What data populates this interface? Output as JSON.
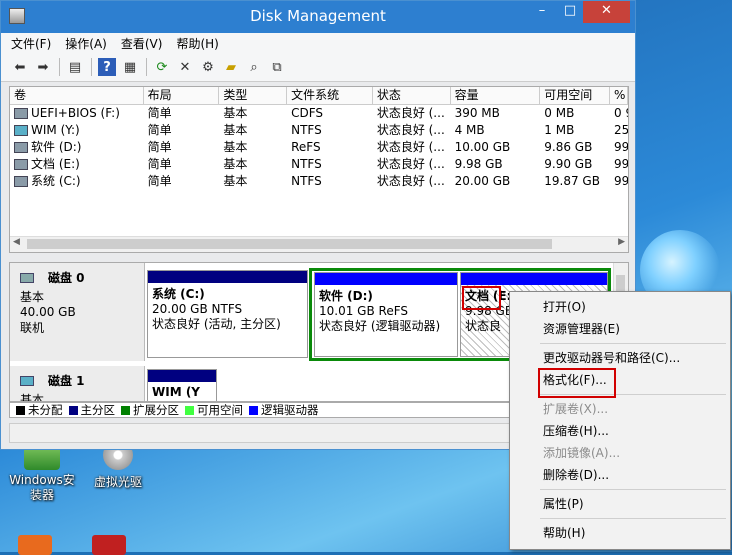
{
  "window": {
    "title": "Disk Management",
    "buttons": {
      "min": "–",
      "max": "□",
      "close": "✕"
    }
  },
  "menubar": [
    "文件(F)",
    "操作(A)",
    "查看(V)",
    "帮助(H)"
  ],
  "toolbar_icons": [
    "back-icon",
    "forward-icon",
    "console-icon",
    "help-icon",
    "properties-icon",
    "refresh-icon",
    "delete-icon",
    "settings-icon",
    "open-folder-icon",
    "search-icon",
    "export-icon"
  ],
  "volumes": {
    "headers": [
      "卷",
      "布局",
      "类型",
      "文件系统",
      "状态",
      "容量",
      "可用空间",
      "%"
    ],
    "rows": [
      [
        "UEFI+BIOS (F:)",
        "简单",
        "基本",
        "CDFS",
        "状态良好 (...",
        "390 MB",
        "0 MB",
        "0 9"
      ],
      [
        "WIM (Y:)",
        "简单",
        "基本",
        "NTFS",
        "状态良好 (...",
        "4 MB",
        "1 MB",
        "25"
      ],
      [
        "软件 (D:)",
        "简单",
        "基本",
        "ReFS",
        "状态良好 (...",
        "10.00 GB",
        "9.86 GB",
        "99"
      ],
      [
        "文档 (E:)",
        "简单",
        "基本",
        "NTFS",
        "状态良好 (...",
        "9.98 GB",
        "9.90 GB",
        "99"
      ],
      [
        "系统 (C:)",
        "简单",
        "基本",
        "NTFS",
        "状态良好 (...",
        "20.00 GB",
        "19.87 GB",
        "99"
      ]
    ]
  },
  "disks": {
    "disk0": {
      "name": "磁盘 0",
      "type": "基本",
      "size": "40.00 GB",
      "state": "联机",
      "parts": {
        "c": {
          "name": "系统  (C:)",
          "size": "20.00 GB NTFS",
          "status": "状态良好 (活动, 主分区)"
        },
        "d": {
          "name": "软件  (D:)",
          "size": "10.01 GB ReFS",
          "status": "状态良好 (逻辑驱动器)"
        },
        "e": {
          "name": "文档",
          "name_rest": "(E:",
          "size": "9.98 GB",
          "status": "状态良"
        }
      }
    },
    "disk1": {
      "name": "磁盘 1",
      "type": "基本",
      "part_name": "WIM  (Y"
    }
  },
  "legend": [
    {
      "label": "未分配",
      "color": "#000000"
    },
    {
      "label": "主分区",
      "color": "#000080"
    },
    {
      "label": "扩展分区",
      "color": "#008000"
    },
    {
      "label": "可用空间",
      "color": "#40ff40"
    },
    {
      "label": "逻辑驱动器",
      "color": "#0000ff"
    }
  ],
  "context_menu": {
    "open": "打开(O)",
    "explorer": "资源管理器(E)",
    "change_letter": "更改驱动器号和路径(C)...",
    "format": "格式化(F)...",
    "extend": "扩展卷(X)...",
    "shrink": "压缩卷(H)...",
    "mirror": "添加镜像(A)...",
    "delete": "删除卷(D)...",
    "properties": "属性(P)",
    "help": "帮助(H)"
  },
  "desktop": {
    "icon1": "Windows安装器",
    "icon2": "虚拟光驱"
  }
}
